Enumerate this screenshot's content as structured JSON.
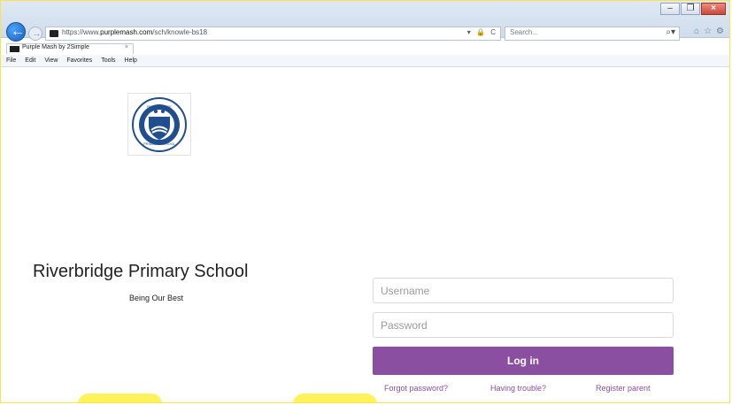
{
  "browser": {
    "address": {
      "prefix": "https://www.",
      "domain": "purplemash.com",
      "path": "/sch/knowle-bs18",
      "actions": "▾ 🔒 C"
    },
    "search": {
      "placeholder": "Search..."
    },
    "tab": {
      "title": "Purple Mash by 2Simple",
      "close": "×"
    },
    "menu": [
      "File",
      "Edit",
      "View",
      "Favorites",
      "Tools",
      "Help"
    ],
    "toolbar_icons": [
      "home-icon",
      "star-icon",
      "gear-icon"
    ]
  },
  "page": {
    "school_name": "Riverbridge Primary School",
    "tagline": "Being Our Best",
    "login": {
      "username_placeholder": "Username",
      "password_placeholder": "Password",
      "button_label": "Log in"
    },
    "links": {
      "forgot": "Forgot password?",
      "trouble": "Having trouble?",
      "register": "Register parent"
    },
    "logo": {
      "top_text": "RIVERBRIDGE",
      "bottom_text": "PRIMARY SCHOOL"
    }
  },
  "colors": {
    "accent": "#8a4fa0",
    "highlight": "#fff35c",
    "browser_blue": "#1760b8"
  }
}
